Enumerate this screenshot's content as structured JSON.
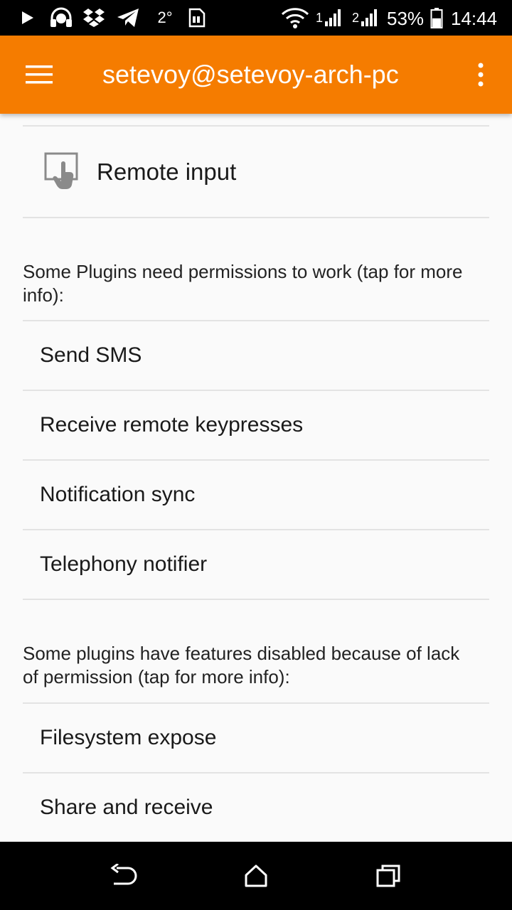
{
  "status_bar": {
    "icons": [
      "play-icon",
      "headset-icon",
      "dropbox-icon",
      "telegram-icon",
      "weather-icon",
      "sim-card-icon",
      "wifi-icon",
      "signal-icon",
      "signal-2-icon",
      "battery-icon"
    ],
    "temperature": "2°",
    "sim1_label": "1",
    "sim2_label": "2",
    "battery_percent": "53%",
    "battery_level": 0.53,
    "time": "14:44"
  },
  "app_bar": {
    "title": "setevoy@setevoy-arch-pc",
    "color": "#f57c00",
    "menu_icon": "hamburger-menu-icon",
    "overflow_icon": "overflow-menu-icon"
  },
  "content": {
    "remote_input": {
      "label": "Remote input",
      "icon": "touchpad-icon"
    },
    "permissions_header": "Some Plugins need permissions to work (tap for more info):",
    "permission_items": [
      "Send SMS",
      "Receive remote keypresses",
      "Notification sync",
      "Telephony notifier"
    ],
    "disabled_header": "Some plugins have features disabled because of lack of permission (tap for more info):",
    "disabled_items": [
      "Filesystem expose",
      "Share and receive"
    ]
  },
  "nav_bar": {
    "icons": [
      "back-icon",
      "home-icon",
      "recents-icon"
    ]
  }
}
